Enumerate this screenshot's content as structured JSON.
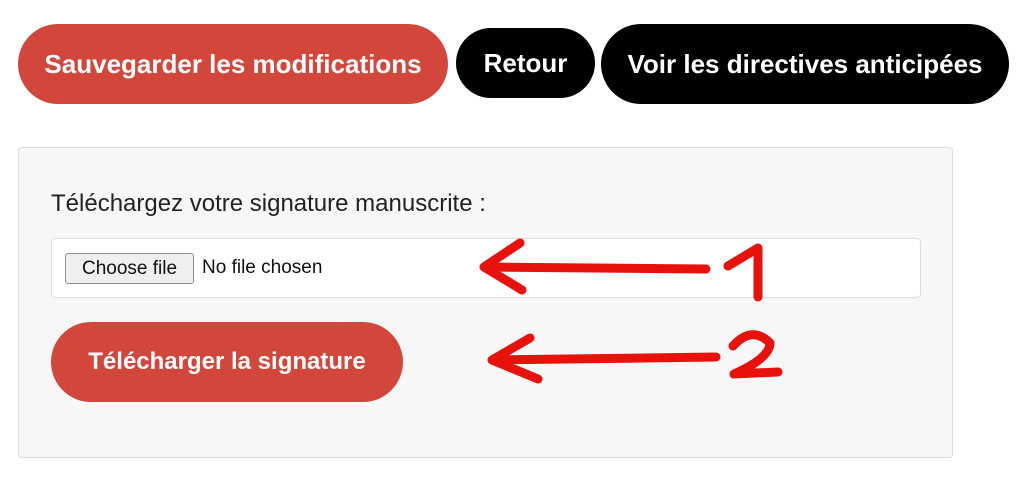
{
  "toolbar": {
    "save_label": "Sauvegarder les modifications",
    "back_label": "Retour",
    "view_label": "Voir les directives anticipées"
  },
  "upload_panel": {
    "label": "Téléchargez votre signature manuscrite :",
    "file_input": {
      "button_label": "Choose file",
      "status": "No file chosen"
    },
    "upload_button_label": "Télécharger la signature"
  },
  "annotations": {
    "marker_1": "1",
    "marker_2": "2",
    "color": "#e8120c"
  },
  "colors": {
    "primary_red": "#d2463b",
    "black": "#000000",
    "panel_bg": "#f7f7f7"
  }
}
